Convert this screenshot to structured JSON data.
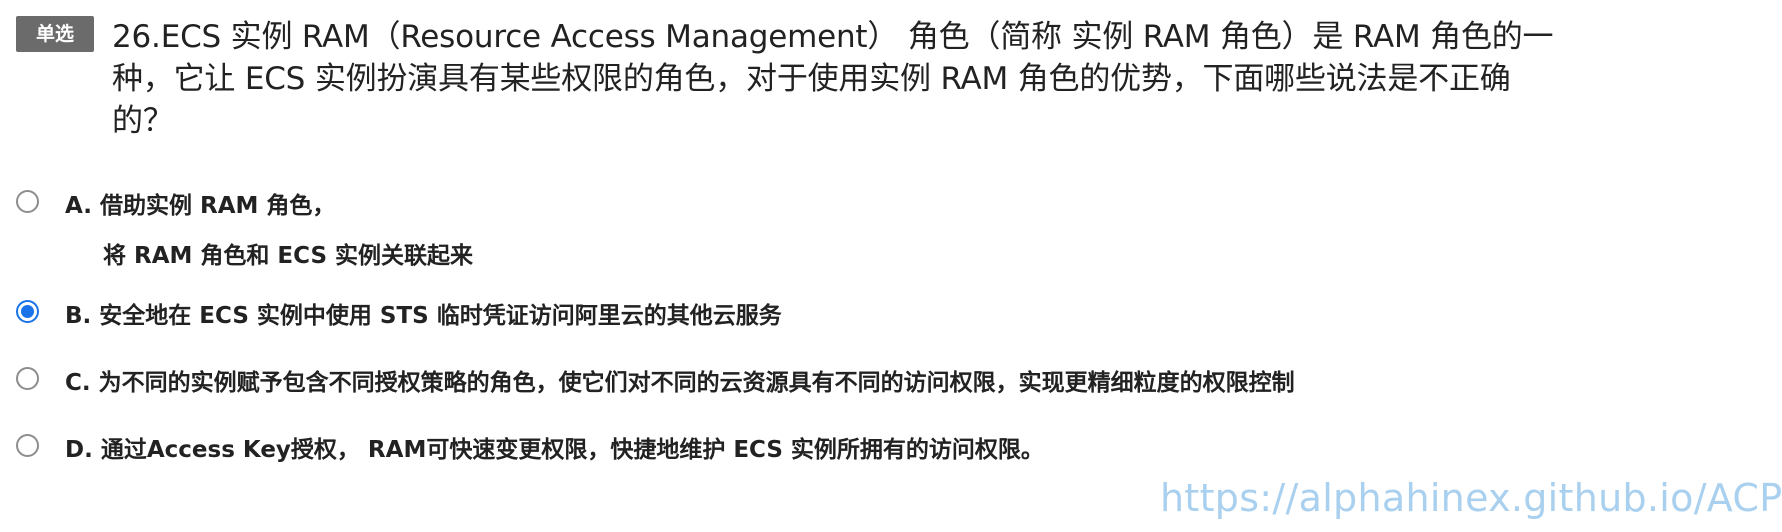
{
  "question": {
    "type_label": "单选",
    "lines": [
      "26.ECS 实例 RAM（Resource Access Management） 角色（简称 实例 RAM 角色）是 RAM 角色的一",
      "种，它让 ECS 实例扮演具有某些权限的角色，对于使用实例 RAM 角色的优势，下面哪些说法是不正确",
      "的？"
    ]
  },
  "options": [
    {
      "letter": "A.",
      "lines": [
        "借助实例 RAM 角色，",
        "将 RAM 角色和 ECS 实例关联起来"
      ],
      "selected": false
    },
    {
      "letter": "B.",
      "lines": [
        "安全地在 ECS 实例中使用 STS 临时凭证访问阿里云的其他云服务"
      ],
      "selected": true
    },
    {
      "letter": "C.",
      "lines": [
        "为不同的实例赋予包含不同授权策略的角色，使它们对不同的云资源具有不同的访问权限，实现更精细粒度的权限控制"
      ],
      "selected": false
    },
    {
      "letter": "D.",
      "lines": [
        "通过Access Key授权， RAM可快速变更权限，快捷地维护 ECS 实例所拥有的访问权限。"
      ],
      "selected": false
    }
  ],
  "watermark": "https://alphahinex.github.io/ACP",
  "colors": {
    "radio_selected": "#1a73e8",
    "radio_unselected": "#8d8d8d",
    "type_badge": "#6b6b6b",
    "watermark": "#a9d0ee"
  }
}
